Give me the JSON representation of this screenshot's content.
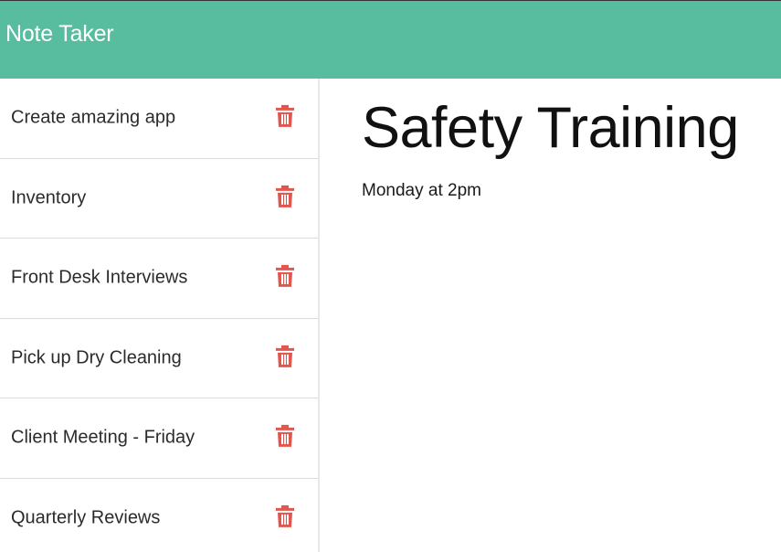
{
  "header": {
    "brand": "Note Taker",
    "background_color": "#58bd9f"
  },
  "sidebar": {
    "notes": [
      {
        "title": "Create amazing app",
        "icon": "trash-icon"
      },
      {
        "title": "Inventory",
        "icon": "trash-icon"
      },
      {
        "title": "Front Desk Interviews",
        "icon": "trash-icon"
      },
      {
        "title": "Pick up Dry Cleaning",
        "icon": "trash-icon"
      },
      {
        "title": "Client Meeting - Friday",
        "icon": "trash-icon"
      },
      {
        "title": "Quarterly Reviews",
        "icon": "trash-icon"
      }
    ],
    "delete_icon_color": "#e0574f"
  },
  "main": {
    "note_title": "Safety Training",
    "note_text": "Monday at 2pm"
  }
}
